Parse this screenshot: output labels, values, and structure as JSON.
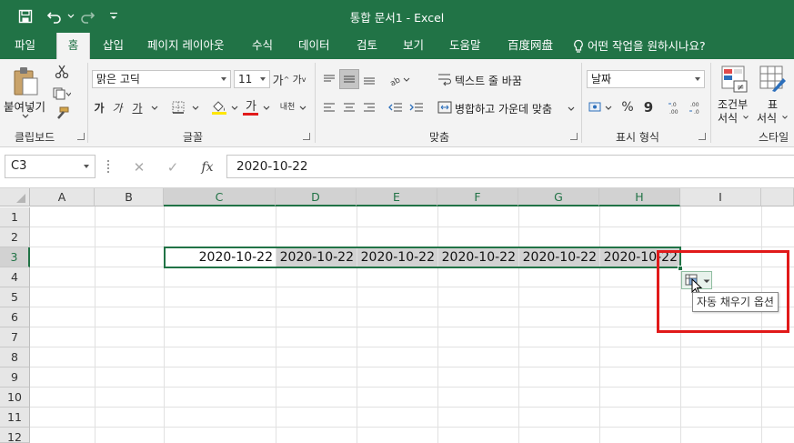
{
  "window": {
    "title": "통합 문서1  -  Excel"
  },
  "quick_access": {
    "save_icon": "save-icon",
    "undo_icon": "undo-icon",
    "redo_icon": "redo-icon",
    "customize_icon": "chevron-down-icon"
  },
  "tabs": [
    "파일",
    "홈",
    "삽입",
    "페이지 레이아웃",
    "수식",
    "데이터",
    "검토",
    "보기",
    "도움말",
    "百度网盘"
  ],
  "active_tab": "홈",
  "tell_me": "어떤 작업을 원하시나요?",
  "ribbon": {
    "clipboard": {
      "paste_label": "붙여넣기",
      "group_label": "클립보드"
    },
    "font": {
      "font_name": "맑은 고딕",
      "font_size": "11",
      "bold": "가",
      "italic": "가",
      "underline": "가",
      "font_color_label": "가",
      "phonetic_label": "내천",
      "group_label": "글꼴",
      "font_color": "#e11a1a",
      "fill_color": "#ffe600"
    },
    "alignment": {
      "wrap_text": "텍스트 줄 바꿈",
      "merge_center": "병합하고 가운데 맞춤",
      "group_label": "맞춤"
    },
    "number": {
      "format": "날짜",
      "percent": "%",
      "comma": "9",
      "group_label": "표시 형식"
    },
    "styles": {
      "conditional_line1": "조건부",
      "conditional_line2": "서식",
      "table_line1": "표",
      "table_line2": "서식",
      "group_label": "스타일"
    }
  },
  "formula_bar": {
    "name_box": "C3",
    "cancel": "✕",
    "enter": "✓",
    "fx": "fx",
    "value": "2020-10-22"
  },
  "columns": [
    "A",
    "B",
    "C",
    "D",
    "E",
    "F",
    "G",
    "H",
    "I"
  ],
  "rows": [
    "1",
    "2",
    "3",
    "4",
    "5",
    "6",
    "7",
    "8",
    "9",
    "10",
    "11",
    "12"
  ],
  "cells": {
    "C3": "2020-10-22",
    "D3": "2020-10-22",
    "E3": "2020-10-22",
    "F3": "2020-10-22",
    "G3": "2020-10-22",
    "H3": "2020-10-22"
  },
  "autofill": {
    "tooltip": "자동 채우기 옵션",
    "icon": "autofill-options-icon"
  },
  "colors": {
    "excel_green": "#217346",
    "highlight_red": "#e11a1a",
    "selection_fill": "#d2d2d2"
  }
}
